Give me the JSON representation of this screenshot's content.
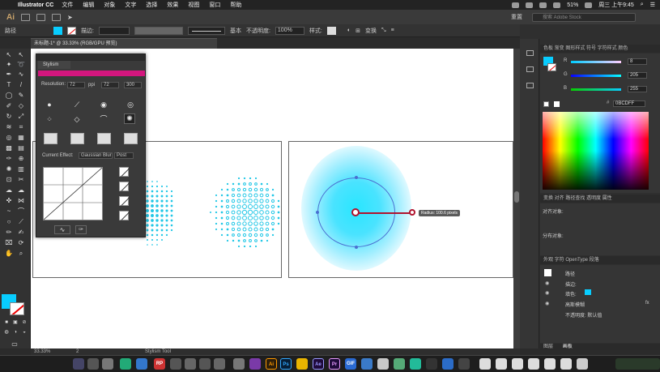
{
  "menubar": {
    "app": "Illustrator CC",
    "items": [
      "文件",
      "编辑",
      "对象",
      "文字",
      "选择",
      "效果",
      "视图",
      "窗口",
      "帮助"
    ],
    "battery": "51%",
    "clock": "周三 上午9:45"
  },
  "approw": {
    "logo": "Ai",
    "workspace": "重置",
    "search_placeholder": "搜索 Adobe Stock"
  },
  "control": {
    "selection_label": "路径",
    "stroke_label": "描边:",
    "stroke_style": "基本",
    "opacity_label": "不透明度:",
    "opacity_value": "100%",
    "style_label": "样式:",
    "transform_label": "变换"
  },
  "document": {
    "tab_title": "未标题-1* @ 33.33% (RGB/GPU 预览)",
    "zoom": "33.33%",
    "page": "2",
    "status": "Stylism Tool"
  },
  "canvas": {
    "tooltip": "Radius: 100.6 pixels"
  },
  "stylism": {
    "title": "Stylism",
    "resolution_label": "Resolution:",
    "resolution_value": "72",
    "ppi": "ppi",
    "res_opt_1": "72",
    "res_opt_2": "300",
    "current_effect_label": "Current Effect:",
    "current_effect_value": "Gaussian Blur",
    "post_label": "Post"
  },
  "color_panel": {
    "tabs": "色板  渐变  图形样式  符号  字符样式  颜色",
    "r_label": "R",
    "g_label": "G",
    "b_label": "B",
    "r_value": "8",
    "g_value": "205",
    "b_value": "255",
    "hex_value": "0BCDFF",
    "fill_color": "#08CDFF"
  },
  "align_panel": {
    "tabs": "变换  对齐  路径查找  透明度  属性",
    "align_objects_label": "对齐对象:",
    "distribute_label": "分布对象:"
  },
  "appearance_panel": {
    "tabs": "外观  字符  OpenType  段落",
    "path_label": "路径",
    "stroke_label": "描边:",
    "fill_label": "填色:",
    "effect_label": "高斯模糊",
    "opacity_label": "不透明度: 默认值",
    "fx_label": "fx"
  },
  "bottom_tabs": {
    "tab1": "图层",
    "tab2": "画板"
  },
  "dock": {
    "apps": [
      "RP",
      "Ai",
      "Ps",
      "Ae",
      "Pr",
      "GIF"
    ]
  }
}
